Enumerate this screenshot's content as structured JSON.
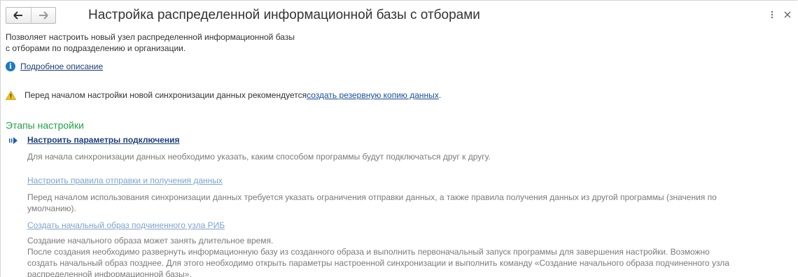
{
  "header": {
    "title": "Настройка распределенной информационной базы с отборами",
    "back_icon": "arrow-left-icon",
    "forward_icon": "arrow-right-icon",
    "more_icon": "more-vertical-icon",
    "close_icon": "close-icon"
  },
  "description": {
    "line1": "Позволяет настроить новый узел распределенной информационной базы",
    "line2": "с отборами по подразделению и организации."
  },
  "details_link": "Подробное описание",
  "warning": {
    "text": "Перед началом настройки новой синхронизации данных рекомендуется ",
    "link": "создать резервную копию данных",
    "suffix": "."
  },
  "stages": {
    "title": "Этапы настройки",
    "items": [
      {
        "label": "Настроить параметры подключения",
        "description": "Для начала синхронизации данных необходимо указать, каким способом программы будут подключаться друг к другу."
      },
      {
        "label": "Настроить правила отправки и получения данных",
        "description_line1": "Перед началом использования синхронизации данных требуется указать ограничения отправки данных, а также правила получения данных из другой программы (значения по",
        "description_line2": "умолчанию)."
      },
      {
        "label": "Создать начальный образ подчиненного узла РИБ",
        "description_line1": "Создание начального образа может занять длительное время.",
        "description_line2": "После создания необходимо развернуть информационную базу из созданного образа и выполнить первоначальный запуск программы для завершения настройки. Возможно",
        "description_line3": "создать начальный образ позднее. Для этого необходимо открыть параметры настроенной синхронизации и выполнить команду «Создание начального образа подчиненного узла",
        "description_line4": "распределенной информационной базы»."
      }
    ]
  },
  "colors": {
    "section_title": "#22a34a",
    "active_link": "#1d3f7a",
    "inactive_link": "#7da3cf",
    "muted_text": "#7a7a7a",
    "warning_icon": "#f2c318"
  }
}
